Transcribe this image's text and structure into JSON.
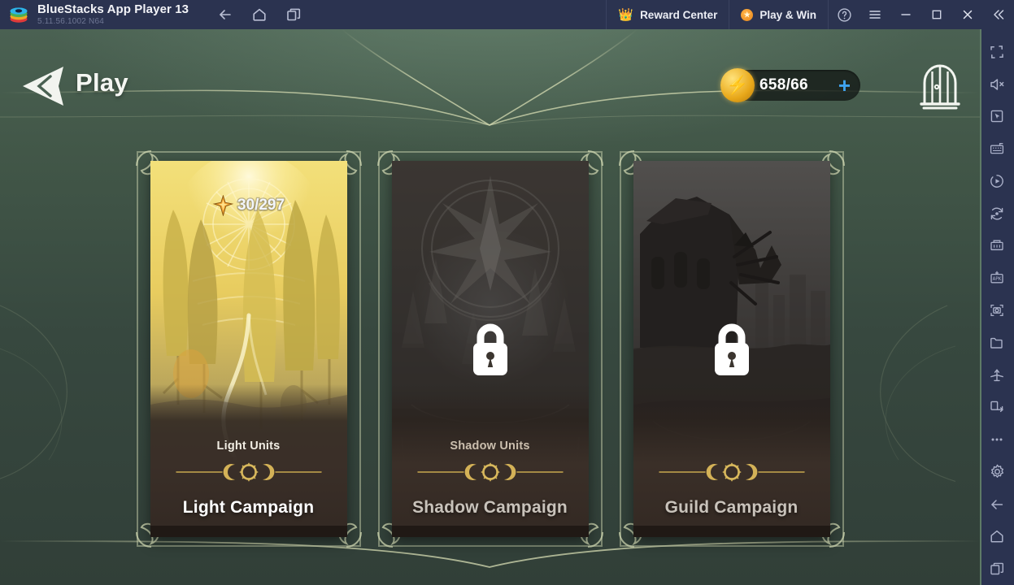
{
  "titlebar": {
    "app_name": "BlueStacks App Player 13",
    "version": "5.11.56.1002  N64",
    "logo_icon": "bluestacks-logo-icon",
    "nav": [
      {
        "name": "back-icon",
        "label": "Back"
      },
      {
        "name": "home-icon",
        "label": "Home"
      },
      {
        "name": "multi-instance-icon",
        "label": "Instances"
      }
    ],
    "reward_center": {
      "label": "Reward Center",
      "icon": "crown-icon"
    },
    "play_and_win": {
      "label": "Play & Win",
      "icon": "orange-badge-icon"
    },
    "help_icon": "help-circle-icon",
    "menu_icon": "hamburger-menu-icon",
    "minimize_icon": "minimize-icon",
    "maximize_icon": "maximize-icon",
    "close_icon": "close-icon",
    "collapse_icon": "double-chevron-left-icon"
  },
  "game": {
    "back_button": "back-chevron-icon",
    "page_title": "Play",
    "energy": {
      "value": "658/66",
      "icon": "energy-lightning-icon",
      "plus_label": "+"
    },
    "gate_button": "gate-icon",
    "cards": [
      {
        "id": "light-campaign",
        "title": "Light Campaign",
        "subtitle": "Light Units",
        "badge": "30/297",
        "badge_icon": "star-icon",
        "locked": false,
        "theme": "light"
      },
      {
        "id": "shadow-campaign",
        "title": "Shadow Campaign",
        "subtitle": "Shadow Units",
        "badge": "",
        "badge_icon": "",
        "locked": true,
        "lock_icon": "lock-icon",
        "theme": "dark"
      },
      {
        "id": "guild-campaign",
        "title": "Guild Campaign",
        "subtitle": "",
        "badge": "",
        "badge_icon": "",
        "locked": true,
        "lock_icon": "lock-icon",
        "theme": "dark"
      }
    ]
  },
  "sidebar": {
    "items": [
      {
        "name": "fullscreen-icon",
        "label": "Fullscreen"
      },
      {
        "name": "mute-icon",
        "label": "Mute"
      },
      {
        "name": "pointer-target-icon",
        "label": "Game controls"
      },
      {
        "name": "keyboard-macro-icon",
        "label": "Macros"
      },
      {
        "name": "script-play-icon",
        "label": "Script"
      },
      {
        "name": "sync-operations-icon",
        "label": "Sync operations"
      },
      {
        "name": "multi-instance-sync-icon",
        "label": "Multi-instance sync"
      },
      {
        "name": "install-apk-icon",
        "label": "Install APK"
      },
      {
        "name": "screenshot-icon",
        "label": "Screenshot"
      },
      {
        "name": "media-folder-icon",
        "label": "Media manager"
      },
      {
        "name": "eco-mode-icon",
        "label": "Eco mode"
      },
      {
        "name": "rotate-screen-icon",
        "label": "Rotate"
      },
      {
        "name": "more-options-icon",
        "label": "More"
      },
      {
        "name": "settings-gear-icon",
        "label": "Settings"
      },
      {
        "name": "back-icon",
        "label": "Back"
      },
      {
        "name": "home-icon",
        "label": "Home"
      },
      {
        "name": "recent-apps-icon",
        "label": "Recent apps"
      }
    ]
  },
  "colors": {
    "titlebar_bg": "#2b3350",
    "game_bg_top": "#4a6152",
    "game_bg_bottom": "#313f38",
    "accent_gold": "#cdd6b0",
    "energy_blue": "#3fa3ef",
    "brand_orange": "#e8861b"
  }
}
